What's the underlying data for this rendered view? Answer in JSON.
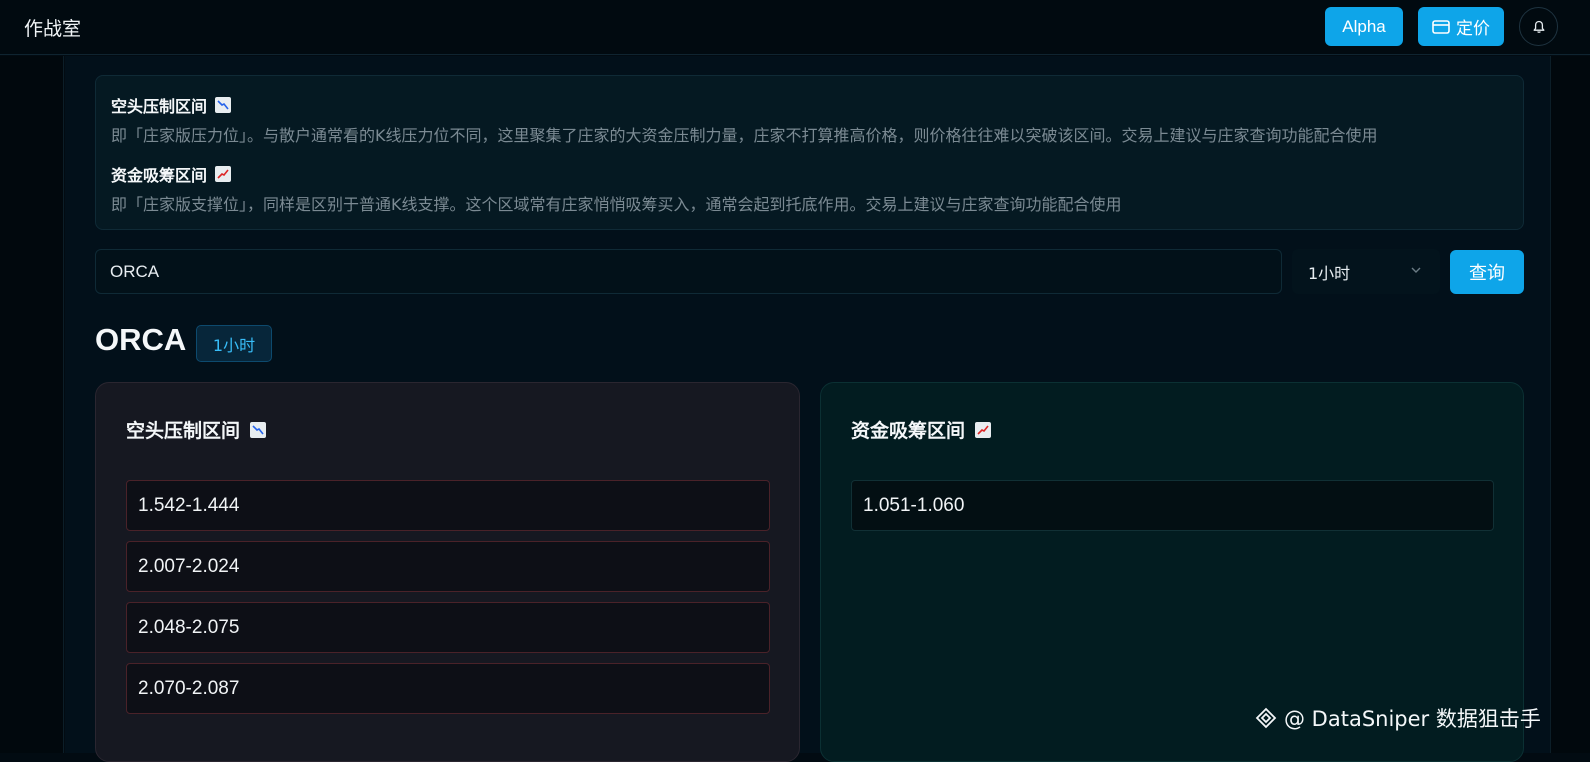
{
  "header": {
    "app_title": "作战室",
    "alpha_label": "Alpha",
    "pricing_label": "定价"
  },
  "info": {
    "short_title": "空头压制区间",
    "short_desc": "即「庄家版压力位」。与散户通常看的K线压力位不同，这里聚集了庄家的大资金压制力量，庄家不打算推高价格，则价格往往难以突破该区间。交易上建议与庄家查询功能配合使用",
    "accum_title": "资金吸筹区间",
    "accum_desc": "即「庄家版支撑位」，同样是区别于普通K线支撑。这个区域常有庄家悄悄吸筹买入，通常会起到托底作用。交易上建议与庄家查询功能配合使用"
  },
  "search": {
    "value": "ORCA",
    "interval": "1小时",
    "query_label": "查询"
  },
  "result": {
    "symbol": "ORCA",
    "interval_badge": "1小时",
    "short_title": "空头压制区间",
    "short_zones": [
      "1.542-1.444",
      "2.007-2.024",
      "2.048-2.075",
      "2.070-2.087"
    ],
    "accum_title": "资金吸筹区间",
    "accum_zones": [
      "1.051-1.060"
    ]
  },
  "watermark": "@ DataSniper 数据狙击手",
  "colors": {
    "accent": "#0ea5e9",
    "background": "#02101a",
    "short_border": "#4a2229",
    "accum_bg": "#021c20"
  },
  "icons": {
    "short": "chart-decreasing-icon",
    "accum": "chart-increasing-icon",
    "pricing": "card-icon",
    "bell": "bell-icon",
    "select": "chevron-down-icon"
  }
}
